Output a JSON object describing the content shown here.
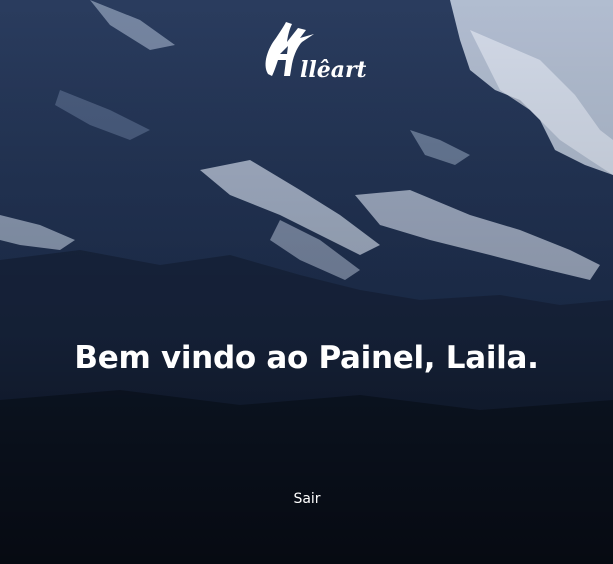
{
  "brand": {
    "logo_text": "Alleart"
  },
  "main": {
    "welcome_message": "Bem vindo ao Painel, Laila.",
    "logout_label": "Sair"
  },
  "colors": {
    "text": "#ffffff",
    "background": "#1c2d4c",
    "snow": "#c9d3e4"
  }
}
